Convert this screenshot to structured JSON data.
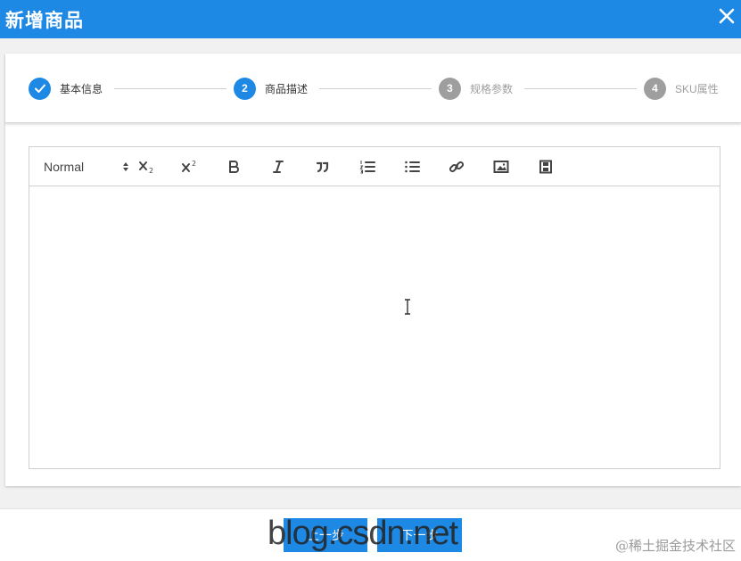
{
  "dialog": {
    "title": "新增商品",
    "close_icon": "close-icon"
  },
  "stepper": {
    "steps": [
      {
        "index": "1",
        "label": "基本信息",
        "state": "done"
      },
      {
        "index": "2",
        "label": "商品描述",
        "state": "active"
      },
      {
        "index": "3",
        "label": "规格参数",
        "state": "pending"
      },
      {
        "index": "4",
        "label": "SKU属性",
        "state": "pending"
      }
    ]
  },
  "editor": {
    "header_picker": "Normal",
    "toolbar": [
      "subscript-icon",
      "superscript-icon",
      "bold-icon",
      "italic-icon",
      "blockquote-icon",
      "ordered-list-icon",
      "bullet-list-icon",
      "link-icon",
      "image-icon",
      "video-icon"
    ]
  },
  "footer": {
    "prev_label": "上一步",
    "next_label": "下一步",
    "watermark": "blog.csdn.net",
    "credit": "@稀土掘金技术社区"
  },
  "colors": {
    "primary": "#1e88e5",
    "pending": "#9e9e9e"
  }
}
